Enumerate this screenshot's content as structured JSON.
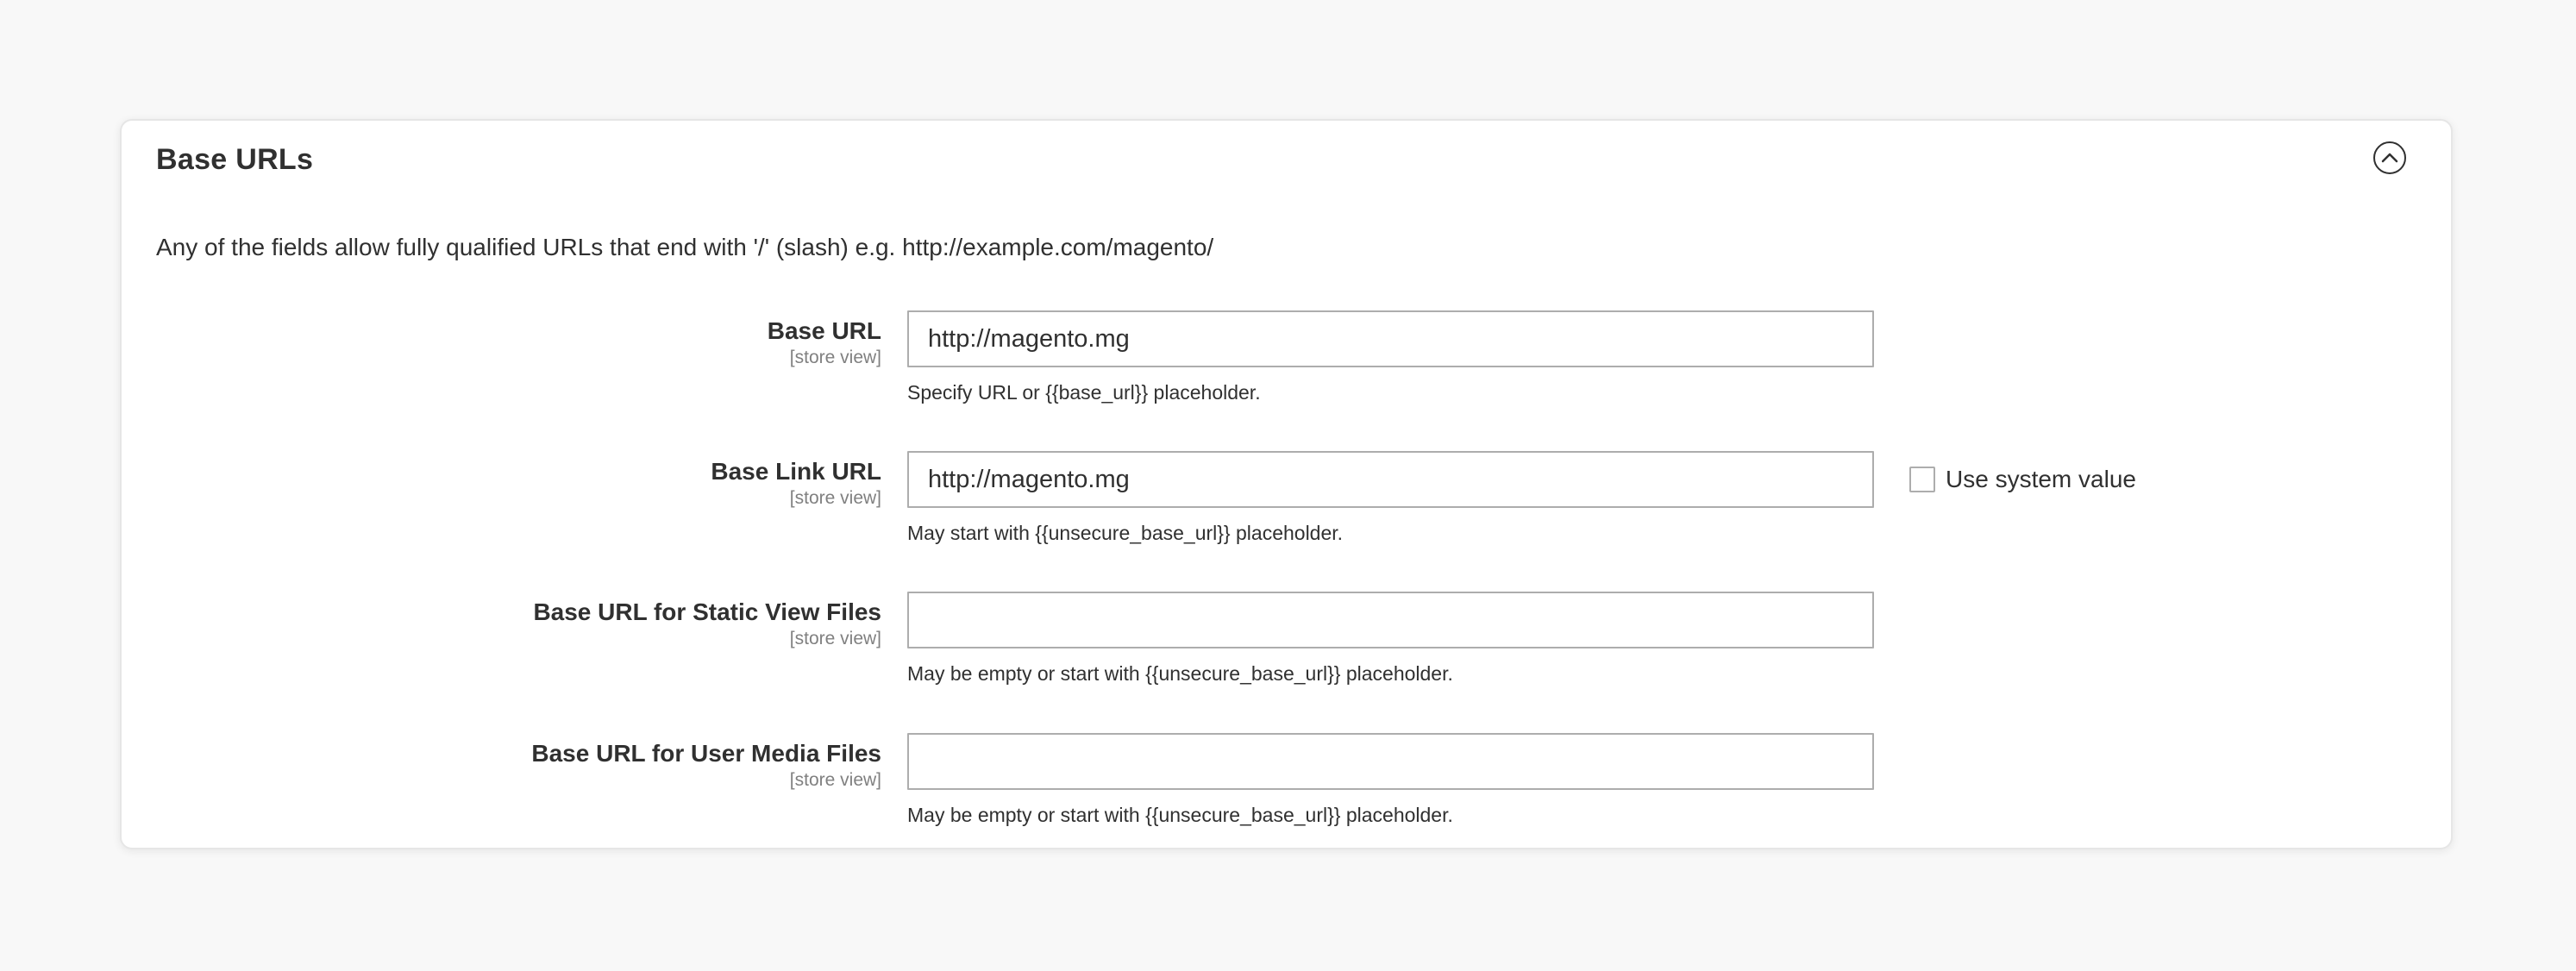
{
  "section": {
    "title": "Base URLs",
    "collapse_icon": "chevron-up-circle-icon",
    "intro": "Any of the fields allow fully qualified URLs that end with '/' (slash) e.g. http://example.com/magento/"
  },
  "fields": [
    {
      "label": "Base URL",
      "scope": "[store view]",
      "value": "http://magento.mg",
      "note": "Specify URL or {{base_url}} placeholder.",
      "use_system_value": null
    },
    {
      "label": "Base Link URL",
      "scope": "[store view]",
      "value": "http://magento.mg",
      "note": "May start with {{unsecure_base_url}} placeholder.",
      "use_system_value": {
        "label": "Use system value",
        "checked": false
      }
    },
    {
      "label": "Base URL for Static View Files",
      "scope": "[store view]",
      "value": "",
      "note": "May be empty or start with {{unsecure_base_url}} placeholder.",
      "use_system_value": null
    },
    {
      "label": "Base URL for User Media Files",
      "scope": "[store view]",
      "value": "",
      "note": "May be empty or start with {{unsecure_base_url}} placeholder.",
      "use_system_value": null
    }
  ]
}
